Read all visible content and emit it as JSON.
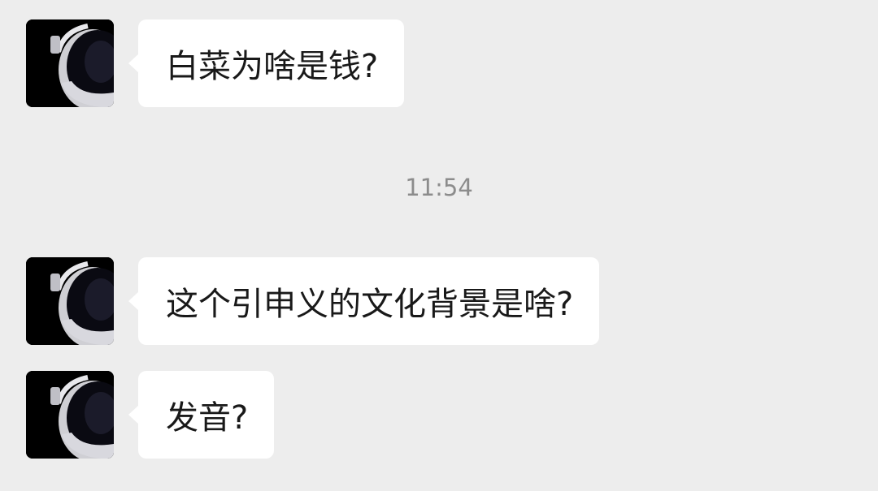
{
  "chat": {
    "messages_group_1": [
      {
        "text": "白菜为啥是钱?"
      }
    ],
    "timestamp": "11:54",
    "messages_group_2": [
      {
        "text": "这个引申义的文化背景是啥?"
      },
      {
        "text": "发音?"
      }
    ]
  },
  "colors": {
    "background": "#ededed",
    "bubble": "#ffffff",
    "text": "#191919",
    "timestamp": "#8c8c8c"
  },
  "icons": {
    "avatar": "astronaut-avatar-icon"
  }
}
